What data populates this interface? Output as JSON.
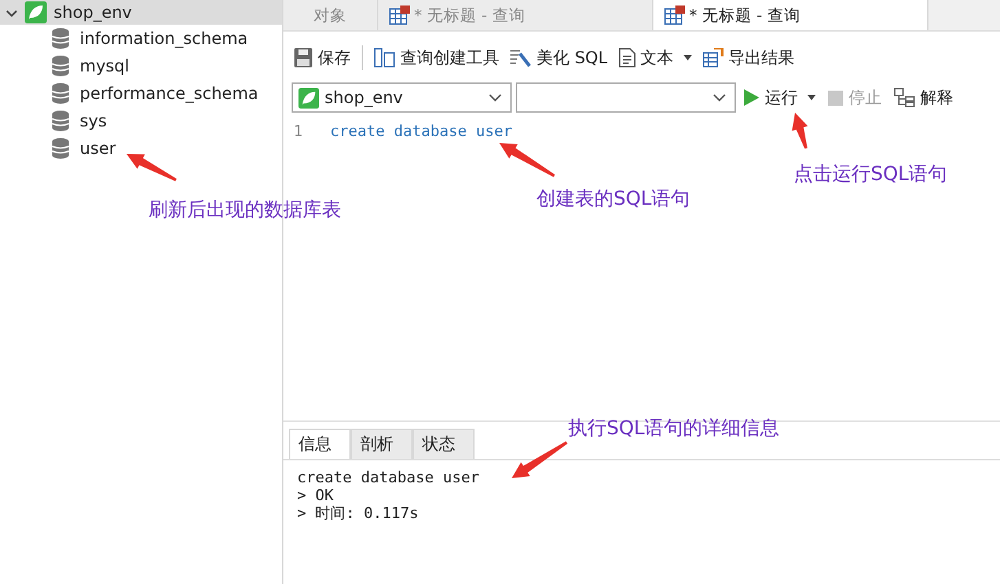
{
  "sidebar": {
    "connection": {
      "name": "shop_env",
      "expanded": true,
      "selected": true
    },
    "databases": [
      {
        "name": "information_schema"
      },
      {
        "name": "mysql"
      },
      {
        "name": "performance_schema"
      },
      {
        "name": "sys"
      },
      {
        "name": "user"
      }
    ]
  },
  "tabs": [
    {
      "label": "对象",
      "kind": "plain",
      "selected": false
    },
    {
      "label": "* 无标题 - 查询",
      "kind": "query",
      "selected": false
    },
    {
      "label": "* 无标题 - 查询",
      "kind": "query",
      "selected": true
    }
  ],
  "toolbar": [
    {
      "label": "保存",
      "kind": "save",
      "dropdown": false
    },
    {
      "label": "查询创建工具",
      "kind": "builder",
      "dropdown": false
    },
    {
      "label": "美化 SQL",
      "kind": "beautify",
      "dropdown": false
    },
    {
      "label": "文本",
      "kind": "text",
      "dropdown": true
    },
    {
      "label": "导出结果",
      "kind": "export",
      "dropdown": false
    }
  ],
  "selectors": [
    {
      "kind": "connection",
      "value": "shop_env"
    },
    {
      "kind": "plain"
    }
  ],
  "run_buttons": [
    {
      "label": "运行",
      "kind": "run",
      "disabled": false,
      "dropdown": true
    },
    {
      "label": "停止",
      "kind": "stop",
      "disabled": true,
      "dropdown": false
    },
    {
      "label": "解释",
      "kind": "explain",
      "disabled": false,
      "dropdown": false
    }
  ],
  "editor": {
    "lines": [
      {
        "number": "1",
        "code": "create database user"
      }
    ]
  },
  "result_tabs": [
    {
      "label": "信息",
      "selected": true
    },
    {
      "label": "剖析",
      "selected": false
    },
    {
      "label": "状态",
      "selected": false
    }
  ],
  "messages": [
    "create database user",
    "> OK",
    "> 时间: 0.117s"
  ],
  "annotations": [
    {
      "text": "刷新后出现的数据库表"
    },
    {
      "text": "创建表的SQL语句"
    },
    {
      "text": "点击运行SQL语句"
    },
    {
      "text": "执行SQL语句的详细信息"
    }
  ]
}
